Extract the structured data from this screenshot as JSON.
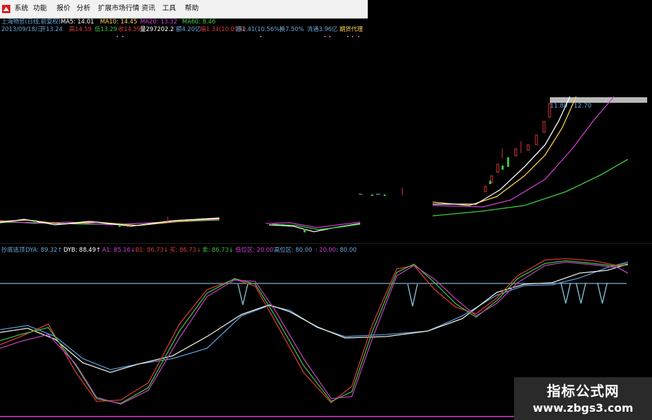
{
  "menu": {
    "items": [
      "系统",
      "功能",
      "报价",
      "分析",
      "扩展市场行情",
      "资讯",
      "工具",
      "帮助"
    ]
  },
  "header": {
    "title": "上海物贸(日线,前复权)",
    "ma": [
      {
        "label": "MA5: 14.01",
        "color": "#ffffff"
      },
      {
        "label": "MA10: 14.45",
        "color": "#ffd24d"
      },
      {
        "label": "MA20: 13.32",
        "color": "#d040d0"
      },
      {
        "label": "MA60: 8.46",
        "color": "#40d040"
      }
    ],
    "info": [
      {
        "text": "2013/09/18/三",
        "color": "#6aa8d8"
      },
      {
        "text": "开13.24",
        "color": "#6aa8d8"
      },
      {
        "text": "高14.59",
        "color": "#d63a3a"
      },
      {
        "text": "低13.29",
        "color": "#40c040"
      },
      {
        "text": "收14.59",
        "color": "#d63a3a"
      },
      {
        "text": "量297202.2",
        "color": "#ffffff"
      },
      {
        "text": "额4.20亿",
        "color": "#6aa8d8"
      },
      {
        "text": "幅1.34(10.09%)",
        "color": "#d63a3a"
      },
      {
        "text": "振1.41(10.56%)",
        "color": "#6aa8d8"
      },
      {
        "text": "换7.50%",
        "color": "#6aa8d8"
      },
      {
        "text": "流通3.96亿",
        "color": "#6aa8d8"
      },
      {
        "text": "期货代理",
        "color": "#ffd24d"
      }
    ]
  },
  "price_labels": [
    "11.80",
    "12.70"
  ],
  "indicator": {
    "items": [
      {
        "text": "抄底逃顶",
        "color": "#6aa8d8"
      },
      {
        "text": "DYA: 89.32↑",
        "color": "#6aa8d8"
      },
      {
        "text": "DYB: 88.49↑",
        "color": "#ffffff"
      },
      {
        "text": "A1: 85.16↓",
        "color": "#d040d0"
      },
      {
        "text": "B1: 86.73↓",
        "color": "#d63a3a"
      },
      {
        "text": "买: 86.73↓",
        "color": "#d63a3a"
      },
      {
        "text": "卖: 86.73↓",
        "color": "#40c040"
      },
      {
        "text": "低位区: 20.00",
        "color": "#d040d0"
      },
      {
        "text": "高位区: 80.00",
        "color": "#6aa8d8"
      },
      {
        "text": ": 20.00",
        "color": "#d040d0"
      },
      {
        "text": ": 80.00",
        "color": "#6aa8d8"
      }
    ]
  },
  "watermark": {
    "title": "指标公式网",
    "url": "www.zbgs3.com"
  },
  "colors": {
    "bg": "#000000",
    "up": "#d63a3a",
    "down": "#40c040",
    "ma5": "#ffffff",
    "ma10": "#ffd24d",
    "ma20": "#d040d0",
    "ma60": "#40d040",
    "level": "#6aa8d8"
  }
}
